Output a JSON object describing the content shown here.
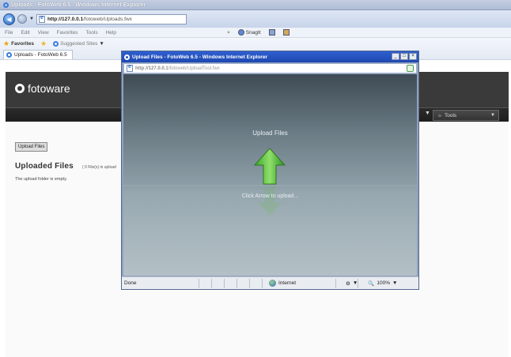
{
  "browser": {
    "window_title": "Uploads - FotoWeb 6.5 - Windows Internet Explorer",
    "url_host": "http://127.0.0.1",
    "url_path": "/fotoweb/Uploads.fwx",
    "menu": [
      "File",
      "Edit",
      "View",
      "Favorites",
      "Tools",
      "Help"
    ],
    "snagit_label": "SnagIt",
    "favorites_label": "Favorites",
    "suggested_sites_label": "Suggested Sites",
    "tab_title": "Uploads - FotoWeb 6.5"
  },
  "fotoweb": {
    "logo_text": "fotoware",
    "tools_label": "Tools",
    "upload_button": "Upload Files",
    "uploaded_title": "Uploaded Files",
    "uploaded_count": "( 0 File(s) in upload",
    "empty_message": "The upload folder is empty."
  },
  "popup": {
    "title": "Upload Files - FotoWeb 6.5 - Windows Internet Explorer",
    "url_host": "http://127.0.0.1",
    "url_path": "/fotoweb/UploadTool.fwx",
    "stage_title": "Upload Files",
    "stage_hint": "Click Arrow to upload...",
    "status_text": "Done",
    "zone_text": "Internet",
    "zoom_text": "100%"
  }
}
